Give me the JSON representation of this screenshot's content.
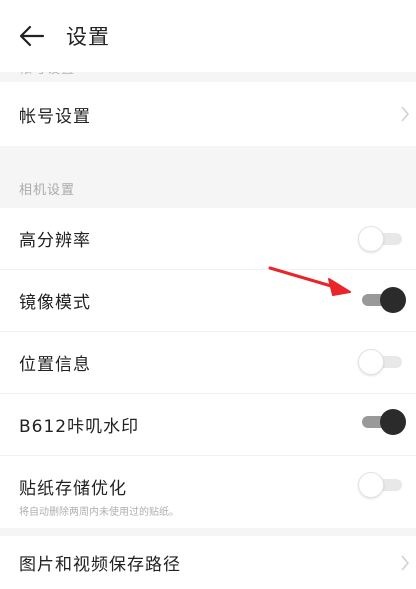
{
  "header": {
    "title": "设置",
    "back_icon": "back-arrow-icon"
  },
  "faded_section_label": "帐号设置",
  "account": {
    "label": "帐号设置",
    "icon": "chevron-right-icon"
  },
  "camera_section": {
    "label": "相机设置"
  },
  "settings": [
    {
      "label": "高分辨率",
      "enabled": false
    },
    {
      "label": "镜像模式",
      "enabled": true
    },
    {
      "label": "位置信息",
      "enabled": false
    },
    {
      "label": "B612咔叽水印",
      "enabled": true
    },
    {
      "label": "贴纸存储优化",
      "sublabel": "将自动删除两周内未使用过的贴纸。",
      "enabled": false
    }
  ],
  "save_path": {
    "label": "图片和视频保存路径",
    "icon": "chevron-right-icon"
  },
  "colors": {
    "toggle_on": "#2b2b2b",
    "toggle_on_track": "#999999",
    "arrow": "#e8262a",
    "section_bg": "#f5f5f5"
  }
}
